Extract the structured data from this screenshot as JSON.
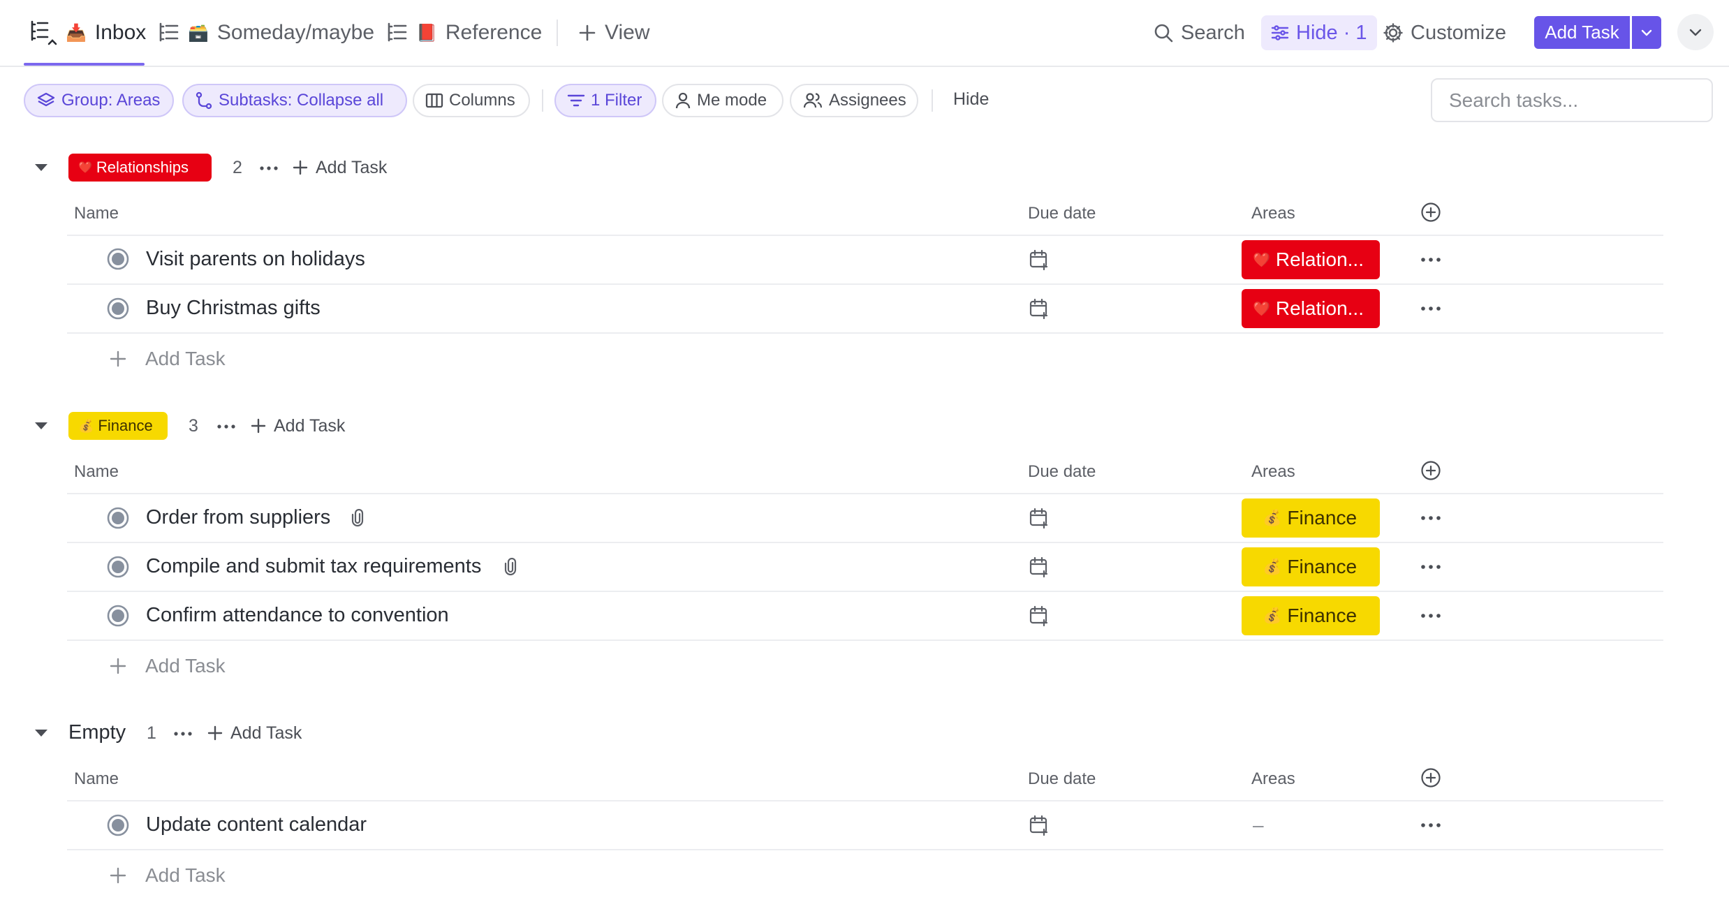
{
  "nav": {
    "tabs": [
      {
        "label": "Inbox",
        "emoji": "📥"
      },
      {
        "label": "Someday/maybe",
        "emoji": "🗃️"
      },
      {
        "label": "Reference",
        "emoji": "📕"
      }
    ],
    "add_view": "View",
    "search": "Search",
    "hide": "Hide · 1",
    "customize": "Customize",
    "add_task": "Add Task"
  },
  "toolbar": {
    "group": "Group: Areas",
    "subtasks": "Subtasks: Collapse all",
    "columns": "Columns",
    "filter": "1 Filter",
    "me_mode": "Me mode",
    "assignees": "Assignees",
    "hide": "Hide",
    "search_placeholder": "Search tasks..."
  },
  "columns": {
    "name": "Name",
    "due": "Due date",
    "areas": "Areas"
  },
  "add_task_label": "Add Task",
  "groups": [
    {
      "label": "Relationships",
      "emoji": "❤️",
      "count": "2",
      "tasks": [
        {
          "name": "Visit parents on holidays",
          "area": "Relation...",
          "area_emoji": "❤️"
        },
        {
          "name": "Buy Christmas gifts",
          "area": "Relation...",
          "area_emoji": "❤️"
        }
      ]
    },
    {
      "label": "Finance",
      "emoji": "💰",
      "count": "3",
      "tasks": [
        {
          "name": "Order from suppliers",
          "area": "Finance",
          "area_emoji": "💰",
          "attachment": true
        },
        {
          "name": "Compile and submit tax requirements",
          "area": "Finance",
          "area_emoji": "💰",
          "attachment": true
        },
        {
          "name": "Confirm attendance to convention",
          "area": "Finance",
          "area_emoji": "💰"
        }
      ]
    },
    {
      "label": "Empty",
      "count": "1",
      "tasks": [
        {
          "name": "Update content calendar",
          "area": "–"
        }
      ]
    }
  ],
  "colors": {
    "accent": "#6754e8",
    "relationships": "#e70013",
    "finance": "#f7d900"
  }
}
